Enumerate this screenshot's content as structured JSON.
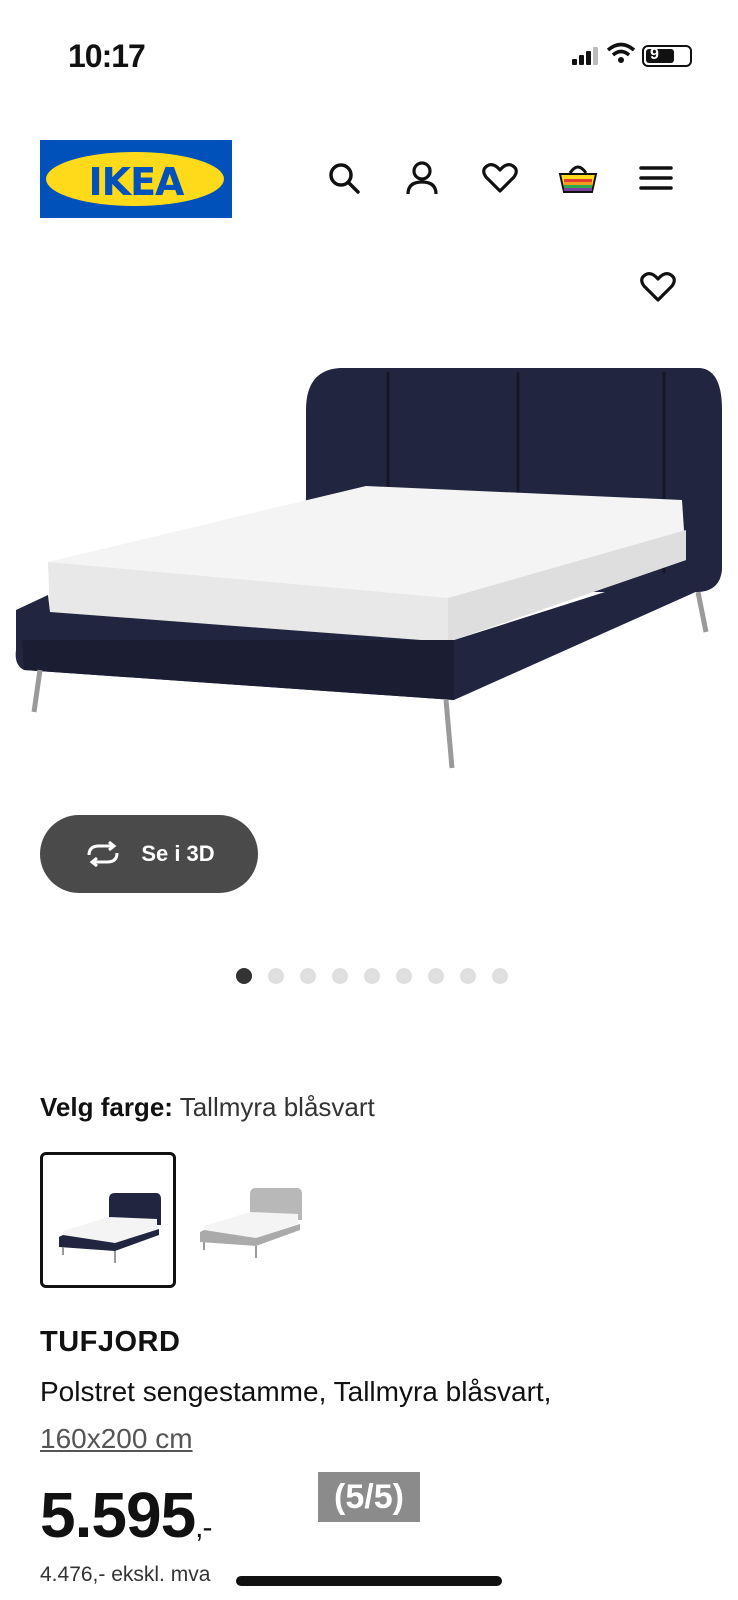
{
  "status_bar": {
    "time": "10:17",
    "battery": "9"
  },
  "header": {
    "logo_text": "IKEA",
    "icons": [
      "search-icon",
      "profile-icon",
      "heart-icon",
      "basket-icon",
      "menu-icon"
    ]
  },
  "gallery": {
    "view_3d_label": "Se i 3D",
    "dots_total": 9,
    "dots_active": 1
  },
  "color": {
    "label": "Velg farge:",
    "value": "Tallmyra blåsvart"
  },
  "product": {
    "name": "TUFJORD",
    "description": "Polstret sengestamme, Tallmyra blåsvart,",
    "size": "160x200 cm",
    "price": "5.595",
    "price_suffix": ",-",
    "price_ex_vat": "4.476,- ekskl. mva"
  },
  "overlay": {
    "counter": "(5/5)"
  },
  "colors": {
    "ikea_blue": "#0051ba",
    "ikea_yellow": "#ffda1a",
    "bed_fabric": "#22253f",
    "button_dark": "#4a4a4a"
  }
}
